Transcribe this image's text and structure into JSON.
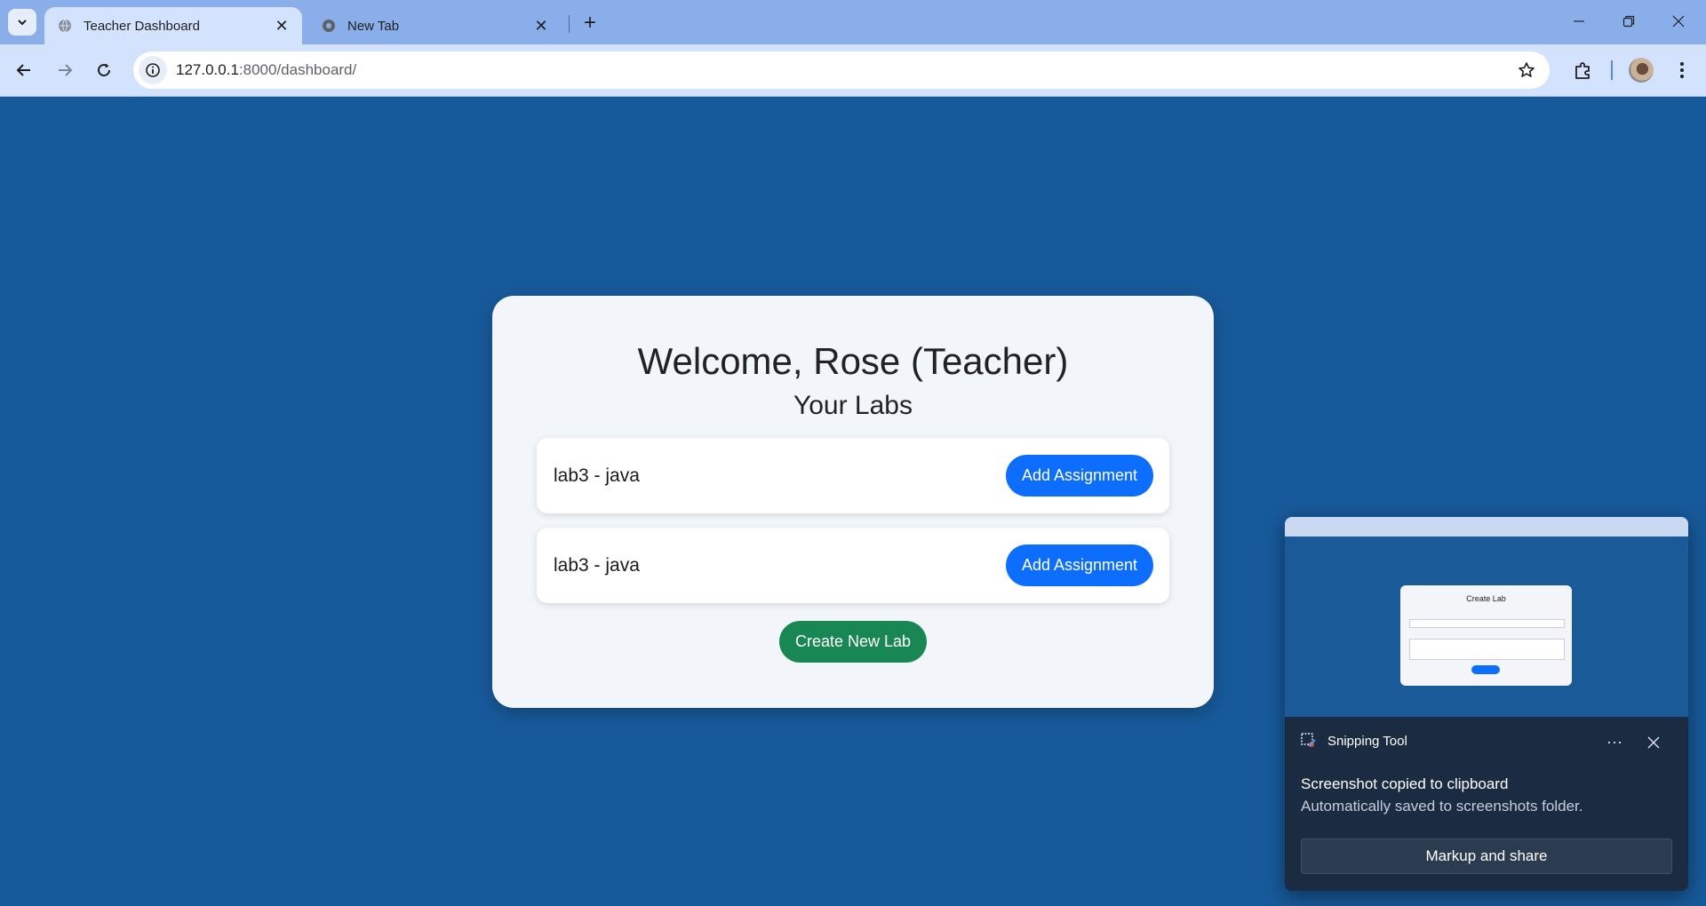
{
  "browser": {
    "tabs": [
      {
        "title": "Teacher Dashboard",
        "active": true
      },
      {
        "title": "New Tab",
        "active": false
      }
    ],
    "address": {
      "host": "127.0.0.1",
      "path": ":8000/dashboard/"
    }
  },
  "dashboard": {
    "welcome": "Welcome, Rose (Teacher)",
    "subtitle": "Your Labs",
    "labs": [
      {
        "name": "lab3 - java",
        "action": "Add Assignment"
      },
      {
        "name": "lab3 - java",
        "action": "Add Assignment"
      }
    ],
    "create_label": "Create New Lab"
  },
  "toast": {
    "app": "Snipping Tool",
    "more": "···",
    "title": "Screenshot copied to clipboard",
    "body": "Automatically saved to screenshots folder.",
    "action": "Markup and share",
    "preview": {
      "card_title": "Create Lab"
    }
  },
  "colors": {
    "page_bg": "#175a9b",
    "primary": "#0d6efd",
    "success": "#198754",
    "tab_strip": "#8aaee9",
    "toolbar": "#d3e2fd"
  }
}
